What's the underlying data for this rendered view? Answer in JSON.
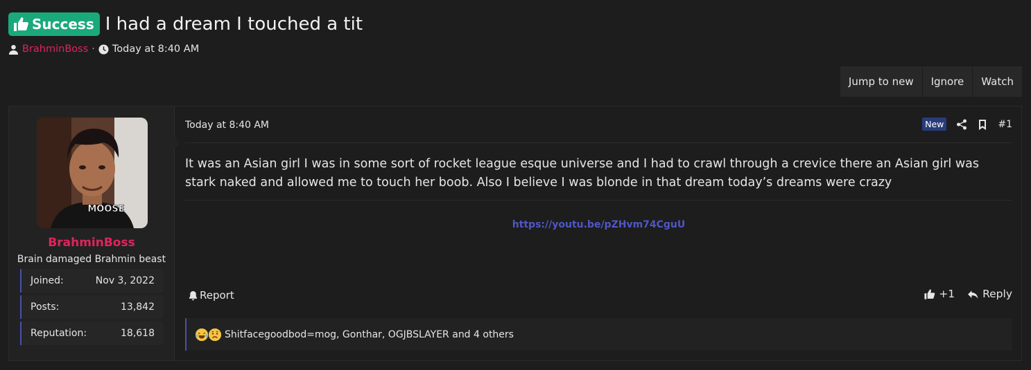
{
  "thread": {
    "prefix": "Success",
    "title": "I had a dream I touched a tit",
    "author": "BrahminBoss",
    "meta_separator": "·",
    "time": "Today at 8:40 AM"
  },
  "toolbar": {
    "jump_label": "Jump to new",
    "ignore_label": "Ignore",
    "watch_label": "Watch"
  },
  "user": {
    "name": "BrahminBoss",
    "title": "Brain damaged Brahmin beast",
    "avatar_caption": "MOOSE",
    "stats": [
      {
        "label": "Joined:",
        "value": "Nov 3, 2022"
      },
      {
        "label": "Posts:",
        "value": "13,842"
      },
      {
        "label": "Reputation:",
        "value": "18,618"
      }
    ]
  },
  "post": {
    "date": "Today at 8:40 AM",
    "new_badge": "New",
    "number": "#1",
    "body": "It was an Asian girl I was in some sort of rocket league esque universe and I had to crawl through a crevice there an Asian girl was stark naked and allowed me to touch her boob. Also I believe I was blonde in that dream today’s dreams were crazy",
    "link": "https://youtu.be/pZHvm74CguU",
    "report_label": "Report",
    "reaction_count": "+1",
    "reply_label": "Reply",
    "reactions_text": "Shitfacegoodbod=mog, Gonthar, OGJBSLAYER and 4 others"
  },
  "colors": {
    "accent": "#4b4fa8",
    "username": "#e0245e",
    "prefix_bg": "#1aa97b",
    "new_badge_bg": "#283c7a",
    "link": "#4f57c6"
  }
}
